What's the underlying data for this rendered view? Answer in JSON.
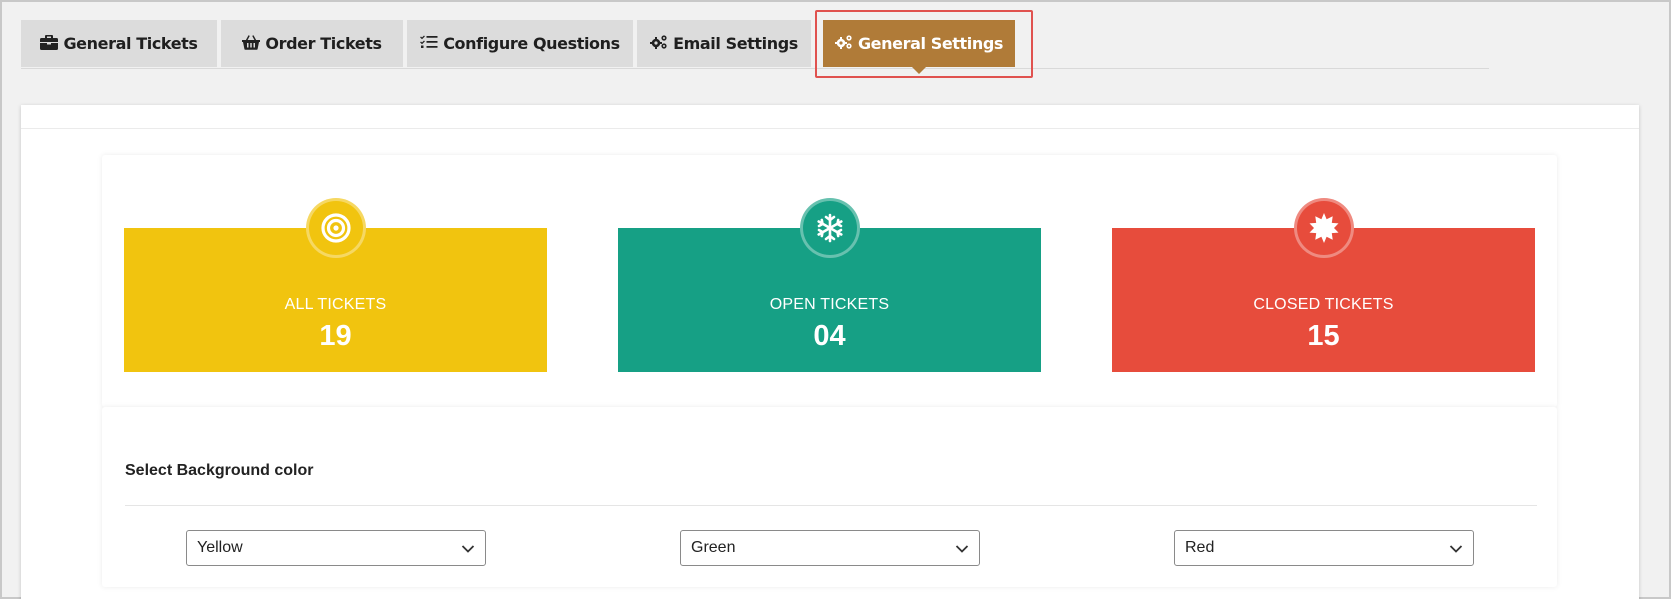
{
  "tabs": [
    {
      "label": "General Tickets",
      "icon": "briefcase-icon",
      "active": false
    },
    {
      "label": "Order Tickets",
      "icon": "basket-icon",
      "active": false
    },
    {
      "label": "Configure Questions",
      "icon": "list-check-icon",
      "active": false
    },
    {
      "label": "Email Settings",
      "icon": "cogs-icon",
      "active": false
    },
    {
      "label": "General Settings",
      "icon": "cogs-icon",
      "active": true
    }
  ],
  "stats": [
    {
      "title": "ALL TICKETS",
      "count": "19",
      "color": "#f1c40f",
      "icon": "target-icon"
    },
    {
      "title": "OPEN TICKETS",
      "count": "04",
      "color": "#16a085",
      "icon": "snowflake-icon"
    },
    {
      "title": "CLOSED TICKETS",
      "count": "15",
      "color": "#e74c3c",
      "icon": "sun-icon"
    }
  ],
  "settings": {
    "title": "Select Background color",
    "selects": [
      {
        "value": "Yellow"
      },
      {
        "value": "Green"
      },
      {
        "value": "Red"
      }
    ]
  },
  "colors": {
    "active_tab": "#b07b38",
    "highlight_border": "#e0524f"
  }
}
